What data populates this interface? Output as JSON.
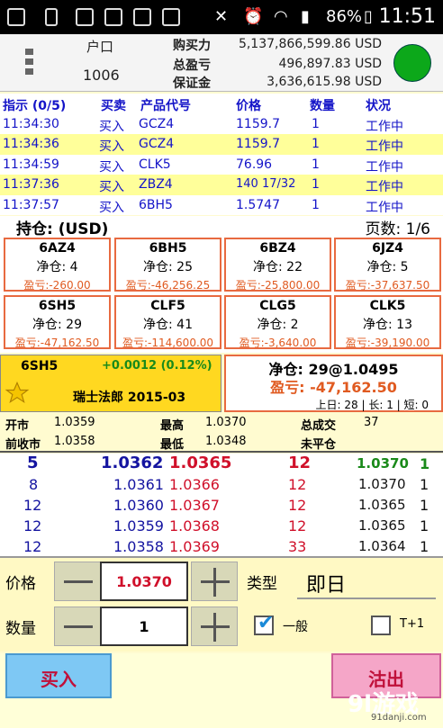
{
  "status_bar": {
    "battery": "86%",
    "time": "11:51"
  },
  "account": {
    "label": "户口",
    "number": "1006",
    "buying_power_label": "购买力",
    "buying_power": "5,137,866,599.86 USD",
    "total_pl_label": "总盈亏",
    "total_pl": "496,897.83 USD",
    "margin_label": "保证金",
    "margin": "3,636,615.98 USD",
    "connection_color": "#0ca81a"
  },
  "orders": {
    "headers": [
      "指示 (0/5)",
      "买卖",
      "产品代号",
      "价格",
      "数量",
      "状况"
    ],
    "rows": [
      [
        "11:34:30",
        "买入",
        "GCZ4",
        "1159.7",
        "1",
        "工作中"
      ],
      [
        "11:34:36",
        "买入",
        "GCZ4",
        "1159.7",
        "1",
        "工作中"
      ],
      [
        "11:34:59",
        "买入",
        "CLK5",
        "76.96",
        "1",
        "工作中"
      ],
      [
        "11:37:36",
        "买入",
        "ZBZ4",
        "140 17/32",
        "1",
        "工作中"
      ],
      [
        "11:37:57",
        "买入",
        "6BH5",
        "1.5747",
        "1",
        "工作中"
      ]
    ]
  },
  "positions": {
    "title": "持仓: (USD)",
    "page": "页数: 1/6",
    "cards": [
      {
        "symbol": "6AZ4",
        "net": "净仓: 4",
        "pl": "盈亏:-260.00"
      },
      {
        "symbol": "6BH5",
        "net": "净仓: 25",
        "pl": "盈亏:-46,256.25"
      },
      {
        "symbol": "6BZ4",
        "net": "净仓: 22",
        "pl": "盈亏:-25,800.00"
      },
      {
        "symbol": "6JZ4",
        "net": "净仓: 5",
        "pl": "盈亏:-37,637.50"
      },
      {
        "symbol": "6SH5",
        "net": "净仓: 29",
        "pl": "盈亏:-47,162.50"
      },
      {
        "symbol": "CLF5",
        "net": "净仓: 41",
        "pl": "盈亏:-114,600.00"
      },
      {
        "symbol": "CLG5",
        "net": "净仓: 2",
        "pl": "盈亏:-3,640.00"
      },
      {
        "symbol": "CLK5",
        "net": "净仓: 13",
        "pl": "盈亏:-39,190.00"
      }
    ]
  },
  "quote": {
    "symbol": "6SH5",
    "change": "+0.0012 (0.12%)",
    "name": "瑞士法郎 2015-03",
    "net_position": "净仓: 29@1.0495",
    "pl": "盈亏: -47,162.50",
    "counts": "上日: 28 | 长: 1 | 短: 0"
  },
  "stats": {
    "open_label": "开市",
    "open": "1.0359",
    "high_label": "最高",
    "high": "1.0370",
    "volume_label": "总成交",
    "volume": "37",
    "prev_label": "前收市",
    "prev": "1.0358",
    "low_label": "最低",
    "low": "1.0348",
    "oi_label": "未平仓"
  },
  "depth": [
    {
      "bid_qty": "5",
      "bid": "1.0362",
      "ask": "1.0365",
      "ask_qty": "12",
      "last": "1.0370",
      "last_qty": "1"
    },
    {
      "bid_qty": "8",
      "bid": "1.0361",
      "ask": "1.0366",
      "ask_qty": "12",
      "last": "1.0370",
      "last_qty": "1"
    },
    {
      "bid_qty": "12",
      "bid": "1.0360",
      "ask": "1.0367",
      "ask_qty": "12",
      "last": "1.0365",
      "last_qty": "1"
    },
    {
      "bid_qty": "12",
      "bid": "1.0359",
      "ask": "1.0368",
      "ask_qty": "12",
      "last": "1.0365",
      "last_qty": "1"
    },
    {
      "bid_qty": "12",
      "bid": "1.0358",
      "ask": "1.0369",
      "ask_qty": "33",
      "last": "1.0364",
      "last_qty": "1"
    }
  ],
  "ticket": {
    "price_label": "价格",
    "price_value": "1.0370",
    "type_label": "类型",
    "type_value": "即日",
    "qty_label": "数量",
    "qty_value": "1",
    "general_label": "一般",
    "general_checked": true,
    "t1_label": "T+1",
    "t1_checked": false
  },
  "actions": {
    "buy_label": "买入",
    "sell_label": "沽出"
  },
  "watermark": {
    "text": "9l游戏",
    "sub": "91danji.com"
  }
}
